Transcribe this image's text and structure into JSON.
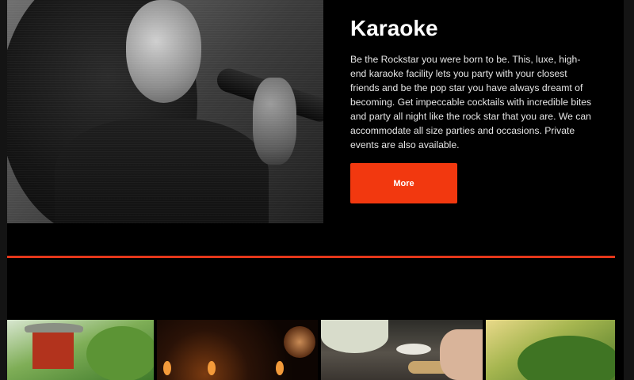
{
  "hero": {
    "title": "Karaoke",
    "description": "Be the Rockstar you were born to be. This, luxe, high-end karaoke facility lets you party with your closest friends and be the pop star you have always dreamt of becoming. Get impeccable cocktails with incredible bites and party all night like the rock star that you are. We can accommodate all size parties and occasions. Private events are also available.",
    "button_label": "More"
  },
  "colors": {
    "accent": "#f2380f",
    "divider": "#e4371a",
    "background": "#000000"
  }
}
